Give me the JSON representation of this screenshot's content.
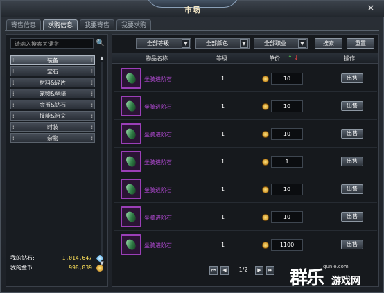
{
  "window": {
    "title": "市场"
  },
  "tabs": [
    {
      "label": "寄售信息",
      "active": false
    },
    {
      "label": "求购信息",
      "active": true
    },
    {
      "label": "我要寄售",
      "active": false
    },
    {
      "label": "我要求购",
      "active": false
    }
  ],
  "search": {
    "placeholder": "请输入搜索关键字"
  },
  "categories": [
    {
      "label": "装备",
      "selected": true
    },
    {
      "label": "宝石",
      "selected": false
    },
    {
      "label": "材料&碎片",
      "selected": false
    },
    {
      "label": "宠物&坐骑",
      "selected": false
    },
    {
      "label": "金币&钻石",
      "selected": false
    },
    {
      "label": "技能&符文",
      "selected": false
    },
    {
      "label": "时装",
      "selected": false
    },
    {
      "label": "杂物",
      "selected": false
    }
  ],
  "wallet": {
    "diamond_label": "我的钻石:",
    "diamond_value": "1,014,647",
    "gold_label": "我的金币:",
    "gold_value": "998,839"
  },
  "filters": {
    "level": "全部等级",
    "color": "全部颜色",
    "job": "全部职业",
    "search_label": "搜索",
    "reset_label": "重置"
  },
  "table": {
    "headers": {
      "name": "物品名称",
      "level": "等级",
      "price": "单价",
      "action": "操作"
    },
    "rows": [
      {
        "name": "坐骑进阶石",
        "level": "1",
        "price": "10",
        "action": "出售"
      },
      {
        "name": "坐骑进阶石",
        "level": "1",
        "price": "10",
        "action": "出售"
      },
      {
        "name": "坐骑进阶石",
        "level": "1",
        "price": "10",
        "action": "出售"
      },
      {
        "name": "坐骑进阶石",
        "level": "1",
        "price": "1",
        "action": "出售"
      },
      {
        "name": "坐骑进阶石",
        "level": "1",
        "price": "10",
        "action": "出售"
      },
      {
        "name": "坐骑进阶石",
        "level": "1",
        "price": "10",
        "action": "出售"
      },
      {
        "name": "坐骑进阶石",
        "level": "1",
        "price": "1100",
        "action": "出售"
      }
    ]
  },
  "pager": {
    "info": "1/2"
  },
  "watermark": {
    "url": "qunle.com",
    "big": "群乐",
    "small": "游戏网"
  },
  "colors": {
    "item_name": "#b44ad6",
    "wallet_value": "#ffe25a",
    "sort_up": "#4cd14c",
    "sort_down": "#e04040"
  }
}
